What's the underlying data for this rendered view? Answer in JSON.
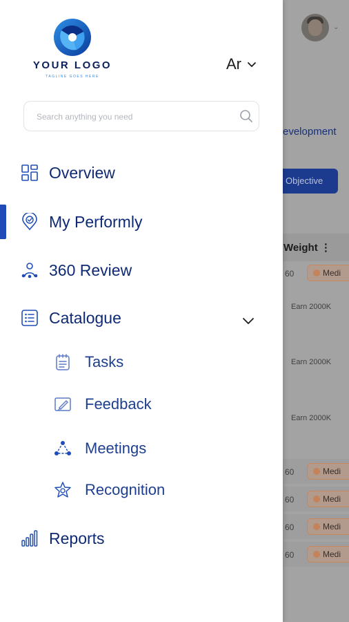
{
  "background": {
    "development_text": "evelopment",
    "objective_button": "Objective",
    "weight_header": "Weight ⋮",
    "rows": [
      {
        "value": "60",
        "pill": "Medi"
      },
      {
        "earn": "Earn 2000K"
      },
      {
        "earn": "Earn 2000K"
      },
      {
        "earn": "Earn 2000K"
      },
      {
        "value": "60",
        "pill": "Medi"
      },
      {
        "value": "60",
        "pill": "Medi"
      },
      {
        "value": "60",
        "pill": "Medi"
      },
      {
        "value": "60",
        "pill": "Medi"
      }
    ]
  },
  "drawer": {
    "logo": {
      "name": "YOUR LOGO",
      "tagline": "TAGLINE GOES HERE"
    },
    "language": {
      "label": "Ar"
    },
    "search": {
      "placeholder": "Search anything you need",
      "value": ""
    },
    "nav": {
      "overview": "Overview",
      "my_performly": "My Performly",
      "review_360": "360 Review",
      "catalogue": "Catalogue",
      "tasks": "Tasks",
      "feedback": "Feedback",
      "meetings": "Meetings",
      "recognition": "Recognition",
      "reports": "Reports"
    },
    "active_item": "my_performly"
  },
  "colors": {
    "brand_navy": "#0e2a74",
    "accent_blue": "#1f4ab8",
    "overlay": "#a3a3a3"
  }
}
